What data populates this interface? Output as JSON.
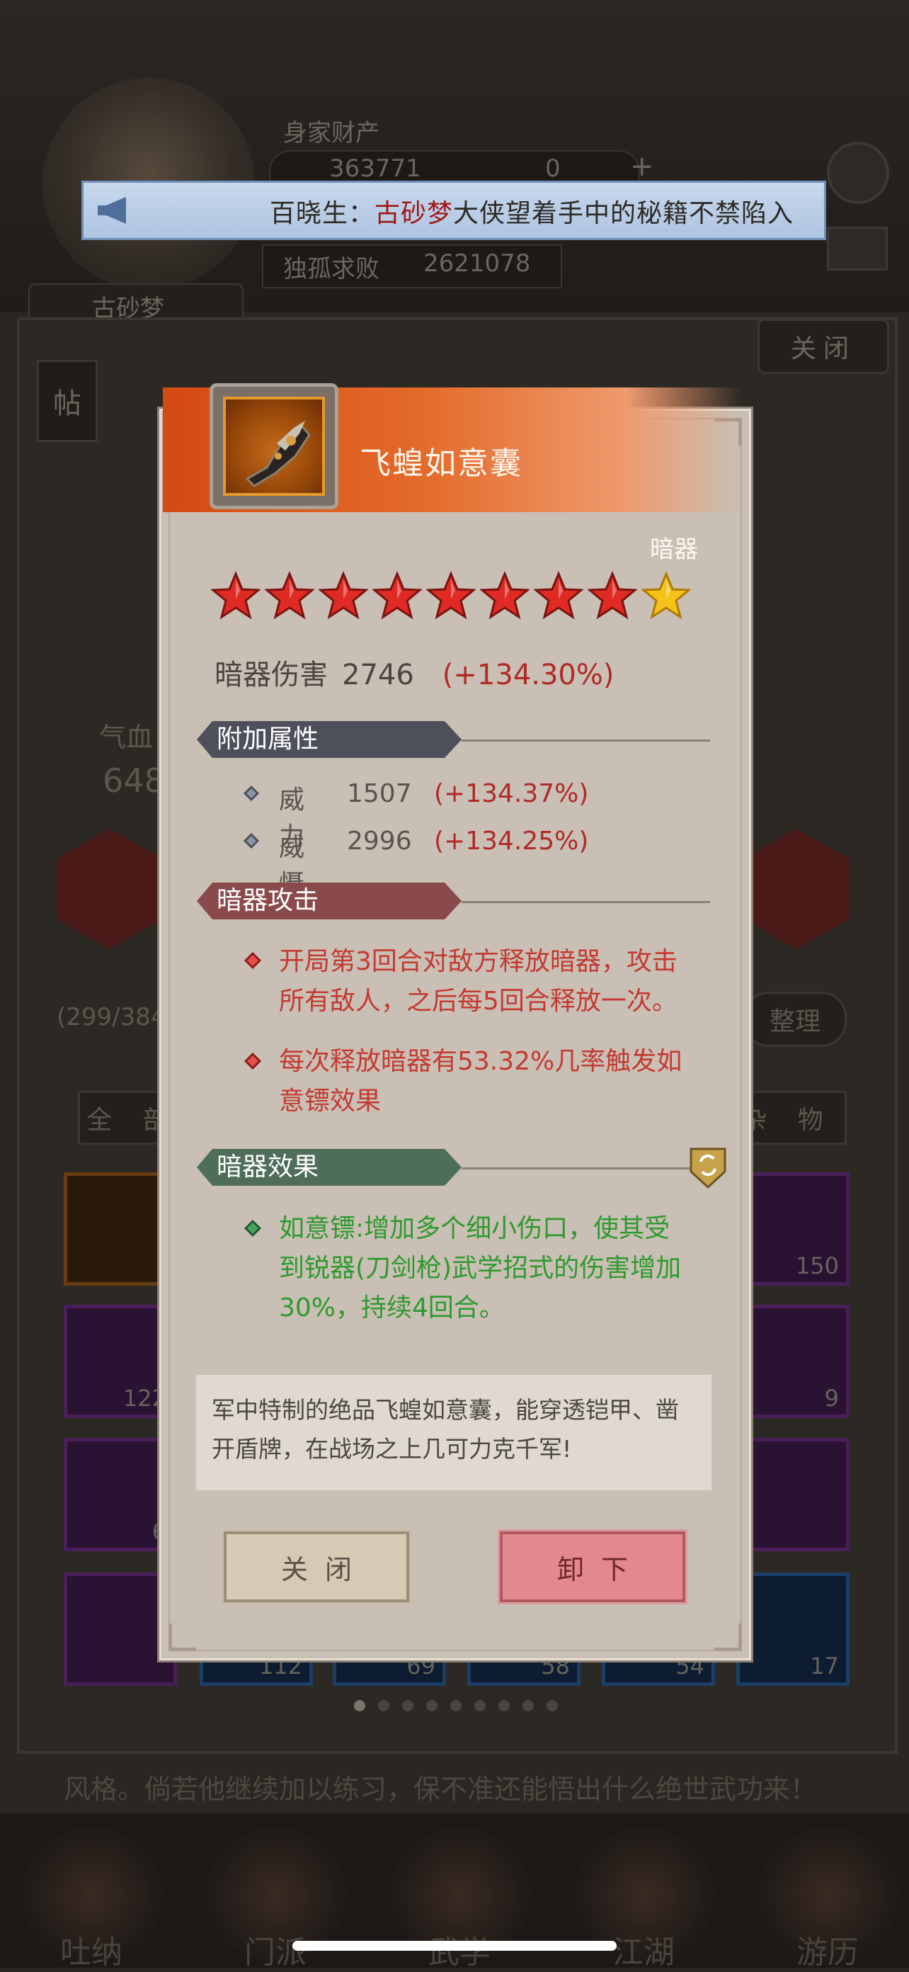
{
  "background": {
    "wealth_label": "身家财产",
    "coins": "363771",
    "gems": "0",
    "plus": "+",
    "rank_label": "独孤求败",
    "rank_value": "2621078",
    "player_name": "古砂梦",
    "side_tag": "帖",
    "close_label": "关闭",
    "hp_label": "气血",
    "hp_value": "648",
    "capacity": "(299/384",
    "sort_label": "整理",
    "filter_all": "全 部",
    "filter_misc": "杂 物",
    "story_line": "风格。倘若他继续加以练习，保不准还能悟出什么绝世武功来！",
    "slots": [
      {
        "count": "",
        "style": "orange"
      },
      {
        "count": "150",
        "style": "purple"
      },
      {
        "count": "122",
        "style": "purple"
      },
      {
        "count": "9",
        "style": "purple"
      },
      {
        "count": "6",
        "style": "purple"
      },
      {
        "count": "",
        "style": "purple"
      },
      {
        "count": "",
        "style": "purple"
      },
      {
        "count": "112",
        "style": "blue"
      },
      {
        "count": "69",
        "style": "blue"
      },
      {
        "count": "58",
        "style": "blue"
      },
      {
        "count": "54",
        "style": "blue"
      },
      {
        "count": "17",
        "style": "blue"
      }
    ],
    "nav": [
      "吐纳",
      "门派",
      "武学",
      "江湖",
      "游历"
    ],
    "page_dots_total": 9,
    "page_dots_active": 1
  },
  "marquee": {
    "prefix": "百晓生：",
    "highlight": "古砂梦",
    "rest": "大侠望着手中的秘籍不禁陷入"
  },
  "item": {
    "name": "飞蝗如意囊",
    "type": "暗器",
    "stars_total": 9,
    "stars_red": 8,
    "stars_gold": 1,
    "main_stat": {
      "label": "暗器伤害",
      "value": "2746",
      "percent": "(+134.30%)"
    }
  },
  "sections": {
    "extra_attrs": {
      "title": "附加属性",
      "rows": [
        {
          "label": "威力",
          "value": "1507",
          "percent": "(+134.37%)"
        },
        {
          "label": "威慑",
          "value": "2996",
          "percent": "(+134.25%)"
        }
      ]
    },
    "attack": {
      "title": "暗器攻击",
      "paras": [
        "开局第3回合对敌方释放暗器，攻击所有敌人，之后每5回合释放一次。",
        "每次释放暗器有53.32%几率触发如意镖效果"
      ]
    },
    "effect": {
      "title": "暗器效果",
      "paras": [
        "如意镖:增加多个细小伤口，使其受到锐器(刀剑枪)武学招式的伤害增加30%，持续4回合。"
      ]
    }
  },
  "description": "军中特制的绝品飞蝗如意囊，能穿透铠甲、凿开盾牌，在战场之上几可力克千军!",
  "buttons": {
    "close": "关闭",
    "unequip": "卸下"
  },
  "colors": {
    "banner": "#d34a12",
    "percent_red": "#b02a26",
    "attack_text": "#c43a32",
    "effect_text": "#2e9a2e",
    "star_red": "#e02a24",
    "star_gold": "#f5c21a"
  }
}
